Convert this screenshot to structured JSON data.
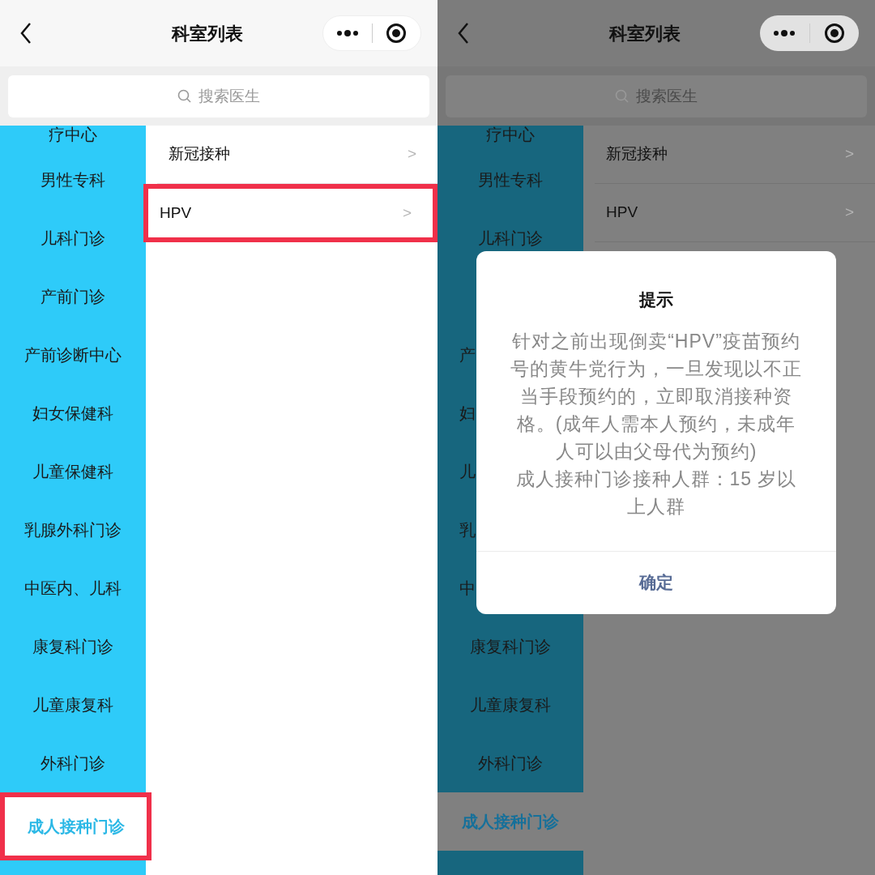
{
  "panels": [
    {
      "dimmed": false,
      "nav": {
        "title": "科室列表"
      },
      "search": {
        "placeholder": "搜索医生"
      },
      "departments": [
        {
          "kind": "top",
          "label": "疗中心",
          "selected": false,
          "highlighted": false
        },
        {
          "kind": "full",
          "label": "男性专科",
          "selected": false,
          "highlighted": false
        },
        {
          "kind": "full",
          "label": "儿科门诊",
          "selected": false,
          "highlighted": false
        },
        {
          "kind": "full",
          "label": "产前门诊",
          "selected": false,
          "highlighted": false
        },
        {
          "kind": "full",
          "label": "产前诊断中心",
          "selected": false,
          "highlighted": false
        },
        {
          "kind": "full",
          "label": "妇女保健科",
          "selected": false,
          "highlighted": false
        },
        {
          "kind": "full",
          "label": "儿童保健科",
          "selected": false,
          "highlighted": false
        },
        {
          "kind": "full",
          "label": "乳腺外科门诊",
          "selected": false,
          "highlighted": false
        },
        {
          "kind": "full",
          "label": "中医内、儿科",
          "selected": false,
          "highlighted": false
        },
        {
          "kind": "full",
          "label": "康复科门诊",
          "selected": false,
          "highlighted": false
        },
        {
          "kind": "full",
          "label": "儿童康复科",
          "selected": false,
          "highlighted": false
        },
        {
          "kind": "full",
          "label": "外科门诊",
          "selected": false,
          "highlighted": false
        },
        {
          "kind": "full",
          "label": "成人接种门诊",
          "selected": true,
          "highlighted": true
        }
      ],
      "subitems": [
        {
          "label": "新冠接种",
          "chevron": ">",
          "highlighted": false
        },
        {
          "label": "HPV",
          "chevron": ">",
          "highlighted": true
        }
      ]
    },
    {
      "dimmed": true,
      "nav": {
        "title": "科室列表"
      },
      "search": {
        "placeholder": "搜索医生"
      },
      "departments": [
        {
          "kind": "top",
          "label": "疗中心",
          "selected": false,
          "highlighted": false
        },
        {
          "kind": "full",
          "label": "男性专科",
          "selected": false,
          "highlighted": false
        },
        {
          "kind": "full",
          "label": "儿科门诊",
          "selected": false,
          "highlighted": false
        },
        {
          "kind": "covered"
        },
        {
          "kind": "partial",
          "label": "产",
          "selected": false,
          "highlighted": false
        },
        {
          "kind": "partial",
          "label": "妇",
          "selected": false,
          "highlighted": false
        },
        {
          "kind": "partial",
          "label": "儿",
          "selected": false,
          "highlighted": false
        },
        {
          "kind": "partial",
          "label": "乳",
          "selected": false,
          "highlighted": false
        },
        {
          "kind": "partial",
          "label": "中",
          "selected": false,
          "highlighted": false
        },
        {
          "kind": "full",
          "label": "康复科门诊",
          "selected": false,
          "highlighted": false
        },
        {
          "kind": "full",
          "label": "儿童康复科",
          "selected": false,
          "highlighted": false
        },
        {
          "kind": "full",
          "label": "外科门诊",
          "selected": false,
          "highlighted": false
        },
        {
          "kind": "full",
          "label": "成人接种门诊",
          "selected": true,
          "highlighted": false
        }
      ],
      "subitems": [
        {
          "label": "新冠接种",
          "chevron": ">",
          "highlighted": false
        },
        {
          "label": "HPV",
          "chevron": ">",
          "highlighted": false
        }
      ],
      "dialog": {
        "title": "提示",
        "paragraphs": [
          "针对之前出现倒卖“HPV”疫苗预约号的黄牛党行为，一旦发现以不正当手段预约的，立即取消接种资格。(成年人需本人预约，未成年人可以由父母代为预约)",
          "成人接种门诊接种人群：15 岁以上人群"
        ],
        "button": "确定"
      }
    }
  ]
}
